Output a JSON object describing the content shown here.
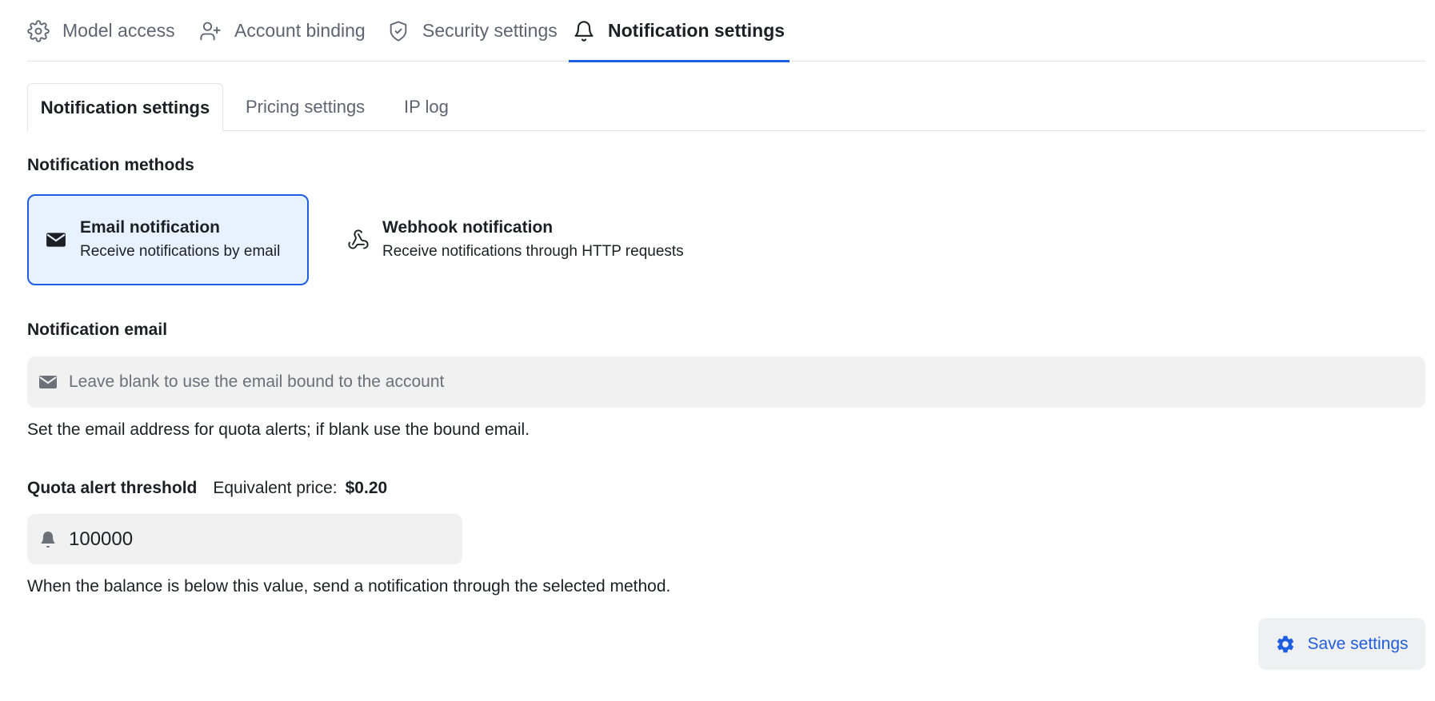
{
  "top_tabs": [
    {
      "label": "Model access",
      "icon": "gear-icon"
    },
    {
      "label": "Account binding",
      "icon": "user-plus-icon"
    },
    {
      "label": "Security settings",
      "icon": "shield-check-icon"
    },
    {
      "label": "Notification settings",
      "icon": "bell-icon",
      "active": true
    }
  ],
  "sub_tabs": [
    {
      "label": "Notification settings",
      "active": true
    },
    {
      "label": "Pricing settings"
    },
    {
      "label": "IP log"
    }
  ],
  "notification_methods": {
    "label": "Notification methods",
    "options": [
      {
        "title": "Email notification",
        "description": "Receive notifications by email",
        "icon": "mail-icon",
        "selected": true
      },
      {
        "title": "Webhook notification",
        "description": "Receive notifications through HTTP requests",
        "icon": "webhook-icon",
        "selected": false
      }
    ]
  },
  "notification_email": {
    "label": "Notification email",
    "placeholder": "Leave blank to use the email bound to the account",
    "value": "",
    "helper": "Set the email address for quota alerts; if blank use the bound email."
  },
  "quota_threshold": {
    "label": "Quota alert threshold",
    "equivalent_label": "Equivalent price:",
    "equivalent_price": "$0.20",
    "value": "100000",
    "helper": "When the balance is below this value, send a notification through the selected method."
  },
  "save_button": {
    "label": "Save settings",
    "icon": "gear-icon"
  },
  "colors": {
    "accent": "#1f5ee0",
    "selected_bg": "#e7f1ff",
    "input_bg": "#f1f1f2"
  }
}
